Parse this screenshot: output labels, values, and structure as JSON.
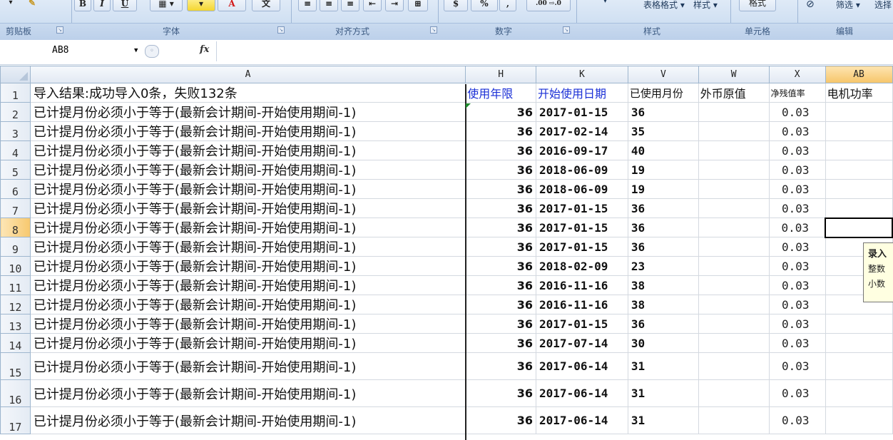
{
  "ribbon": {
    "buttons": {
      "bold": "B",
      "italic": "I",
      "underline": "U",
      "font_color_letter": "A",
      "wen": "文",
      "percent": "%",
      "comma": ",",
      "decimal": ".00 ⇨.0"
    },
    "table_format": "表格格式 ▾",
    "styles": "样式 ▾",
    "cell_format": "格式",
    "filter": "筛选 ▾",
    "select": "选择",
    "groups": [
      "剪贴板",
      "字体",
      "对齐方式",
      "数字",
      "样式",
      "单元格",
      "编辑"
    ]
  },
  "formula_bar": {
    "name_box": "AB8",
    "fx": "fx",
    "value": ""
  },
  "columns": [
    "A",
    "H",
    "K",
    "V",
    "W",
    "X",
    "AB"
  ],
  "selected_column": "AB",
  "selected_row": "8",
  "header_row": {
    "row": "1",
    "a": "导入结果:成功导入0条，失败132条",
    "h": "使用年限",
    "k": "开始使用日期",
    "v": "已使用月份",
    "w": "外币原值",
    "x": "净残值率",
    "ab": "电机功率"
  },
  "rows": [
    {
      "row": "2",
      "a": "已计提月份必须小于等于(最新会计期间-开始使用期间-1)",
      "h": "36",
      "k": "2017-01-15",
      "v": "36",
      "x": "0.03"
    },
    {
      "row": "3",
      "a": "已计提月份必须小于等于(最新会计期间-开始使用期间-1)",
      "h": "36",
      "k": "2017-02-14",
      "v": "35",
      "x": "0.03"
    },
    {
      "row": "4",
      "a": "已计提月份必须小于等于(最新会计期间-开始使用期间-1)",
      "h": "36",
      "k": "2016-09-17",
      "v": "40",
      "x": "0.03"
    },
    {
      "row": "5",
      "a": "已计提月份必须小于等于(最新会计期间-开始使用期间-1)",
      "h": "36",
      "k": "2018-06-09",
      "v": "19",
      "x": "0.03"
    },
    {
      "row": "6",
      "a": "已计提月份必须小于等于(最新会计期间-开始使用期间-1)",
      "h": "36",
      "k": "2018-06-09",
      "v": "19",
      "x": "0.03"
    },
    {
      "row": "7",
      "a": "已计提月份必须小于等于(最新会计期间-开始使用期间-1)",
      "h": "36",
      "k": "2017-01-15",
      "v": "36",
      "x": "0.03"
    },
    {
      "row": "8",
      "a": "已计提月份必须小于等于(最新会计期间-开始使用期间-1)",
      "h": "36",
      "k": "2017-01-15",
      "v": "36",
      "x": "0.03"
    },
    {
      "row": "9",
      "a": "已计提月份必须小于等于(最新会计期间-开始使用期间-1)",
      "h": "36",
      "k": "2017-01-15",
      "v": "36",
      "x": "0.03"
    },
    {
      "row": "10",
      "a": "已计提月份必须小于等于(最新会计期间-开始使用期间-1)",
      "h": "36",
      "k": "2018-02-09",
      "v": "23",
      "x": "0.03"
    },
    {
      "row": "11",
      "a": "已计提月份必须小于等于(最新会计期间-开始使用期间-1)",
      "h": "36",
      "k": "2016-11-16",
      "v": "38",
      "x": "0.03"
    },
    {
      "row": "12",
      "a": "已计提月份必须小于等于(最新会计期间-开始使用期间-1)",
      "h": "36",
      "k": "2016-11-16",
      "v": "38",
      "x": "0.03"
    },
    {
      "row": "13",
      "a": "已计提月份必须小于等于(最新会计期间-开始使用期间-1)",
      "h": "36",
      "k": "2017-01-15",
      "v": "36",
      "x": "0.03"
    },
    {
      "row": "14",
      "a": "已计提月份必须小于等于(最新会计期间-开始使用期间-1)",
      "h": "36",
      "k": "2017-07-14",
      "v": "30",
      "x": "0.03"
    },
    {
      "row": "15",
      "a": "已计提月份必须小于等于(最新会计期间-开始使用期间-1)",
      "h": "36",
      "k": "2017-06-14",
      "v": "31",
      "x": "0.03"
    },
    {
      "row": "16",
      "a": "已计提月份必须小于等于(最新会计期间-开始使用期间-1)",
      "h": "36",
      "k": "2017-06-14",
      "v": "31",
      "x": "0.03"
    },
    {
      "row": "17",
      "a": "已计提月份必须小于等于(最新会计期间-开始使用期间-1)",
      "h": "36",
      "k": "2017-06-14",
      "v": "31",
      "x": "0.03"
    }
  ],
  "tooltip": {
    "line1": "录入",
    "line2": "整数",
    "line3": "小数"
  },
  "colors": {
    "header_blue": "#1a2fd6",
    "selected_header": "#f6c56a",
    "error_marker": "#1f8a2e"
  }
}
